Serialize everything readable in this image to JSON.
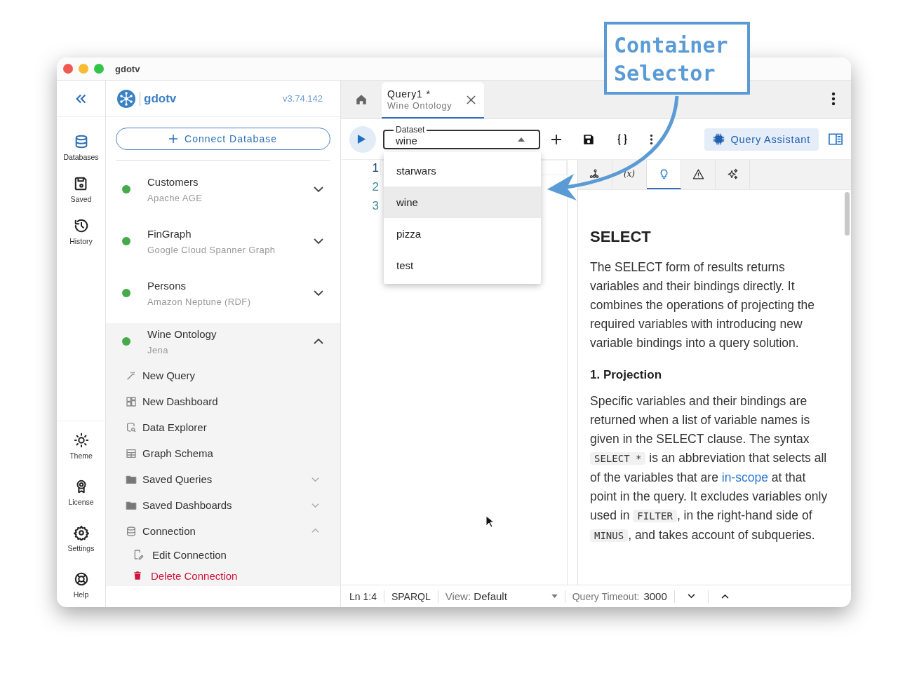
{
  "window": {
    "title": "gdotv"
  },
  "rail": {
    "top": [
      {
        "label": "Databases",
        "selected": true
      },
      {
        "label": "Saved",
        "selected": false
      },
      {
        "label": "History",
        "selected": false
      }
    ],
    "bottom": [
      {
        "label": "Theme"
      },
      {
        "label": "License"
      },
      {
        "label": "Settings"
      },
      {
        "label": "Help"
      }
    ]
  },
  "sidebar": {
    "brand": "gdotv",
    "version": "v3.74.142",
    "connect_button": "Connect Database",
    "connections": [
      {
        "name": "Customers",
        "type": "Apache AGE",
        "connected": true,
        "expanded": false
      },
      {
        "name": "FinGraph",
        "type": "Google Cloud Spanner Graph",
        "connected": true,
        "expanded": false
      },
      {
        "name": "Persons",
        "type": "Amazon Neptune (RDF)",
        "connected": true,
        "expanded": false
      },
      {
        "name": "Wine Ontology",
        "type": "Jena",
        "connected": true,
        "expanded": true,
        "menu": [
          {
            "label": "New Query"
          },
          {
            "label": "New Dashboard"
          },
          {
            "label": "Data Explorer"
          },
          {
            "label": "Graph Schema"
          },
          {
            "label": "Saved Queries",
            "expanded": false
          },
          {
            "label": "Saved Dashboards",
            "expanded": false
          },
          {
            "label": "Connection",
            "expanded": true,
            "children": [
              {
                "label": "Edit Connection",
                "kind": "normal"
              },
              {
                "label": "Delete Connection",
                "kind": "danger"
              }
            ]
          }
        ]
      }
    ]
  },
  "tabs": [
    {
      "title": "Query1 *",
      "subtitle": "Wine Ontology",
      "selected": true
    }
  ],
  "toolbar": {
    "dataset": {
      "label": "Dataset",
      "value": "wine",
      "open": true
    },
    "assistant_button": "Query Assistant"
  },
  "dataset_options": [
    {
      "label": "starwars",
      "selected": false
    },
    {
      "label": "wine",
      "selected": true
    },
    {
      "label": "pizza",
      "selected": false
    },
    {
      "label": "test",
      "selected": false
    }
  ],
  "editor": {
    "line_numbers": [
      "1",
      "2",
      "3"
    ]
  },
  "docs": {
    "tabs": [
      {
        "selected": false
      },
      {
        "label": "(x)",
        "selected": false
      },
      {
        "selected": true
      },
      {
        "selected": false
      },
      {
        "selected": false
      }
    ],
    "heading": "SELECT",
    "intro": "The SELECT form of results returns variables and their bindings directly. It combines the operations of projecting the required variables with introducing new variable bindings into a query solution.",
    "section": "1. Projection",
    "paragraph": [
      {
        "kind": "text",
        "text": "Specific variables and their bindings are returned when a list of variable names is given in the SELECT clause. The syntax "
      },
      {
        "kind": "code",
        "text": "SELECT *"
      },
      {
        "kind": "text",
        "text": " is an abbreviation that selects all of the variables that are "
      },
      {
        "kind": "link",
        "text": "in-scope"
      },
      {
        "kind": "text",
        "text": " at that point in the query. It excludes variables only used in "
      },
      {
        "kind": "code",
        "text": "FILTER"
      },
      {
        "kind": "text",
        "text": ", in the right-hand side of "
      },
      {
        "kind": "code",
        "text": "MINUS"
      },
      {
        "kind": "text",
        "text": ", and takes account of subqueries."
      }
    ]
  },
  "status_bar": {
    "position": "Ln 1:4",
    "language": "SPARQL",
    "view_label": "View:",
    "view_value": "Default",
    "timeout_label": "Query Timeout:",
    "timeout_value": "3000"
  },
  "callout": {
    "text": "Container Selector"
  }
}
